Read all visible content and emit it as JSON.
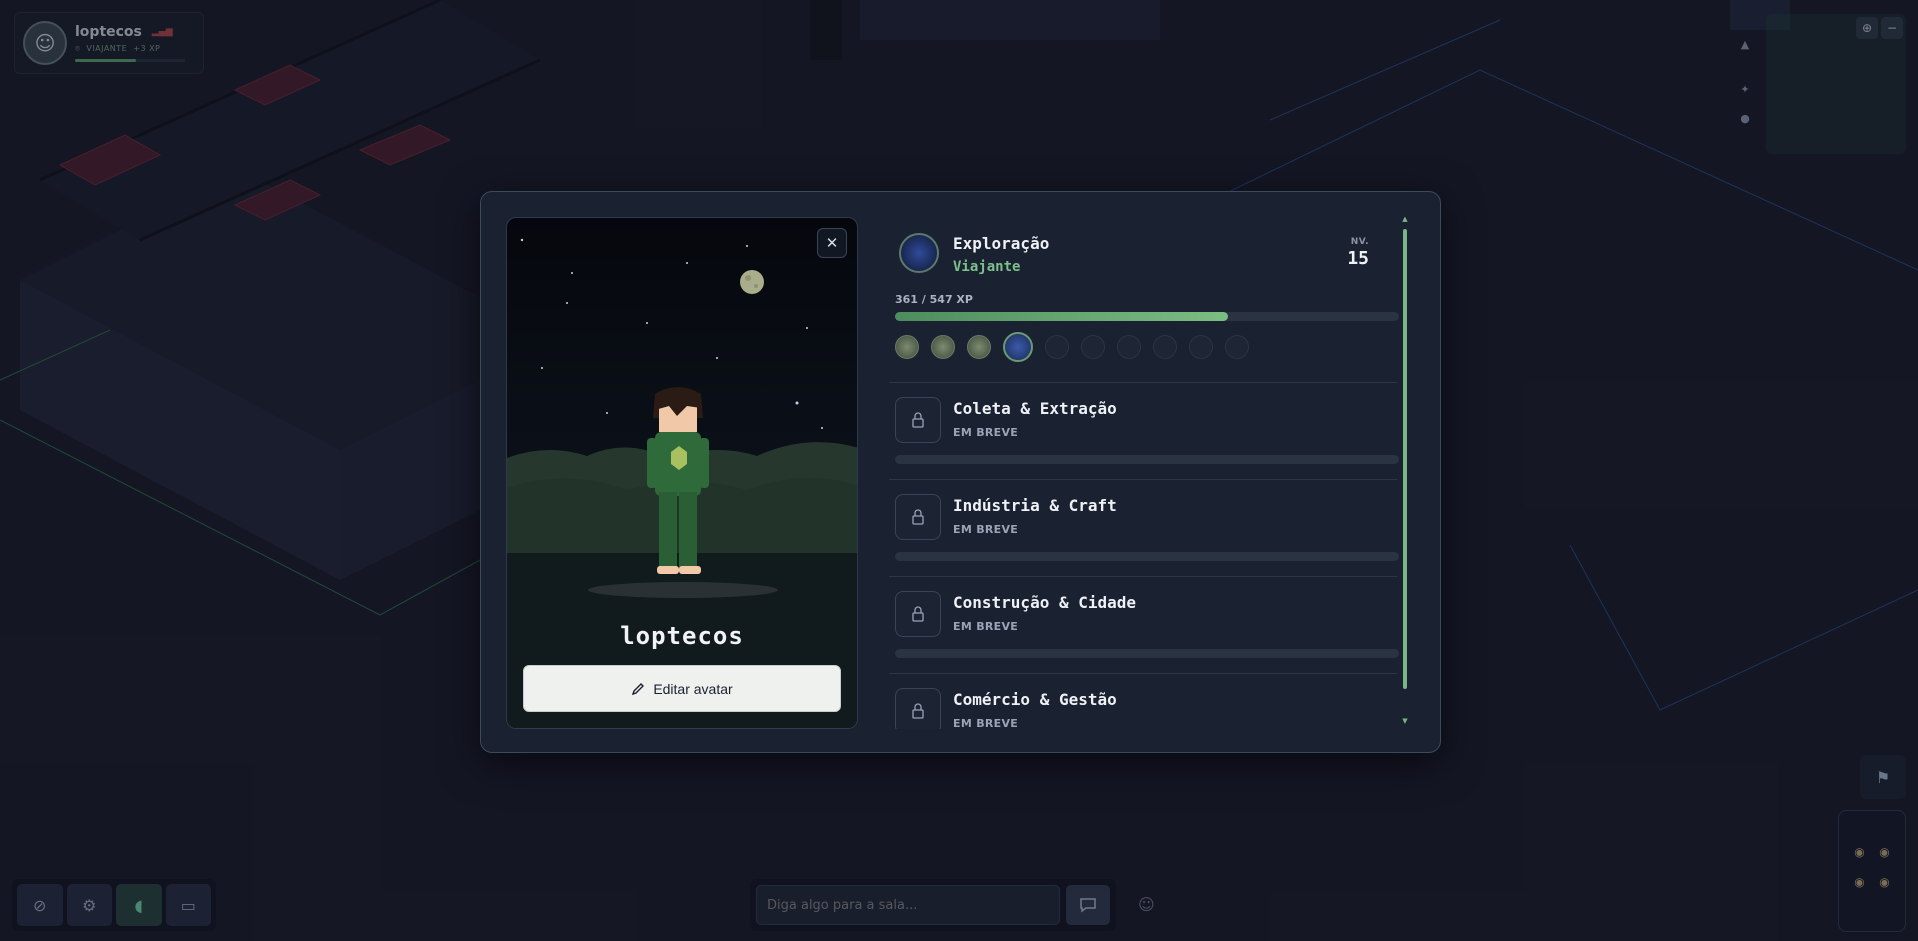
{
  "hud": {
    "player": {
      "name": "loptecos",
      "role": "VIAJANTE",
      "xp_gain": "+3 XP"
    },
    "chat": {
      "placeholder": "Diga algo para a sala..."
    }
  },
  "modal": {
    "avatar": {
      "name": "loptecos",
      "edit_label": "Editar avatar"
    },
    "main_skill": {
      "title": "Exploração",
      "rank": "Viajante",
      "level_label": "NV.",
      "level": "15",
      "xp_text": "361 / 547 XP",
      "xp_progress": 0.66,
      "tiers_completed": 3,
      "tier_current_index": 3,
      "tiers_total": 10
    },
    "locked_skills": [
      {
        "title": "Coleta & Extração",
        "status": "EM BREVE"
      },
      {
        "title": "Indústria & Craft",
        "status": "EM BREVE"
      },
      {
        "title": "Construção & Cidade",
        "status": "EM BREVE"
      },
      {
        "title": "Comércio & Gestão",
        "status": "EM BREVE"
      }
    ]
  },
  "colors": {
    "accent_green": "#7bbd82",
    "modal_bg": "#1a2130",
    "page_bg": "#1a1c2a"
  },
  "icons": {
    "close": "close-icon",
    "edit": "pencil-icon",
    "lock": "lock-icon",
    "send": "chat-bubble-icon"
  }
}
